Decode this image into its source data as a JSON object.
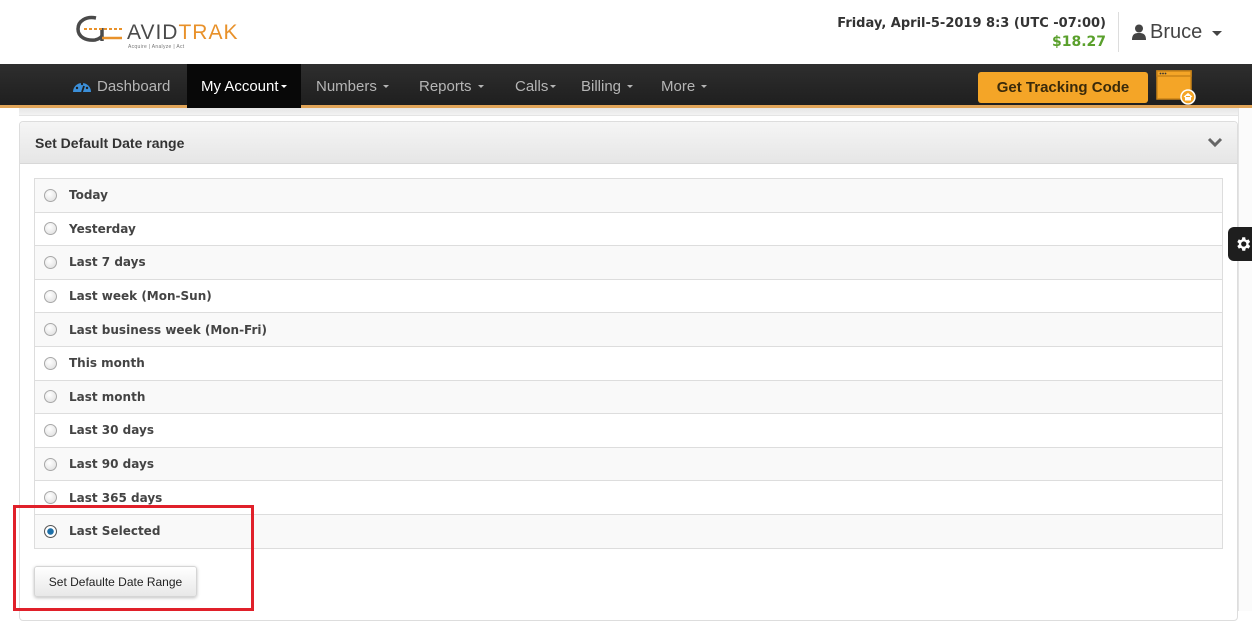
{
  "header": {
    "logo": {
      "brand_left": "AVID",
      "brand_right": "TRAK",
      "tagline": "Acquire  |  Analyze  |  Act"
    },
    "datetime": "Friday, April-5-2019 8:3 (UTC -07:00)",
    "balance": "$18.27",
    "user": {
      "name": "Bruce",
      "icon": "user-icon"
    }
  },
  "navbar": {
    "items": [
      {
        "label": "Dashboard",
        "icon": "dashboard-gauge-icon",
        "active": false,
        "dropdown": false
      },
      {
        "label": "My Account",
        "active": true,
        "dropdown": true
      },
      {
        "label": "Numbers",
        "active": false,
        "dropdown": true
      },
      {
        "label": "Reports",
        "active": false,
        "dropdown": true
      },
      {
        "label": "Calls",
        "active": false,
        "dropdown": true
      },
      {
        "label": "Billing",
        "active": false,
        "dropdown": true
      },
      {
        "label": "More",
        "active": false,
        "dropdown": true
      }
    ],
    "tracking_button": "Get Tracking Code",
    "tracking_icon": "browser-home-icon"
  },
  "panel": {
    "title": "Set Default Date range",
    "collapse_icon": "chevron-down-icon",
    "options": [
      {
        "label": "Today",
        "checked": false
      },
      {
        "label": "Yesterday",
        "checked": false
      },
      {
        "label": "Last 7 days",
        "checked": false
      },
      {
        "label": "Last week (Mon-Sun)",
        "checked": false
      },
      {
        "label": "Last business week (Mon-Fri)",
        "checked": false
      },
      {
        "label": "This month",
        "checked": false
      },
      {
        "label": "Last month",
        "checked": false
      },
      {
        "label": "Last 30 days",
        "checked": false
      },
      {
        "label": "Last 90 days",
        "checked": false
      },
      {
        "label": "Last 365 days",
        "checked": false
      },
      {
        "label": "Last Selected",
        "checked": true
      }
    ],
    "submit_button": "Set Defaulte Date Range"
  },
  "side_widget": {
    "icon": "gear-icon"
  },
  "colors": {
    "accent_orange": "#f4a527",
    "balance_green": "#5aa02c",
    "highlight_red": "#e0202a",
    "navbar_dark": "#262626"
  }
}
